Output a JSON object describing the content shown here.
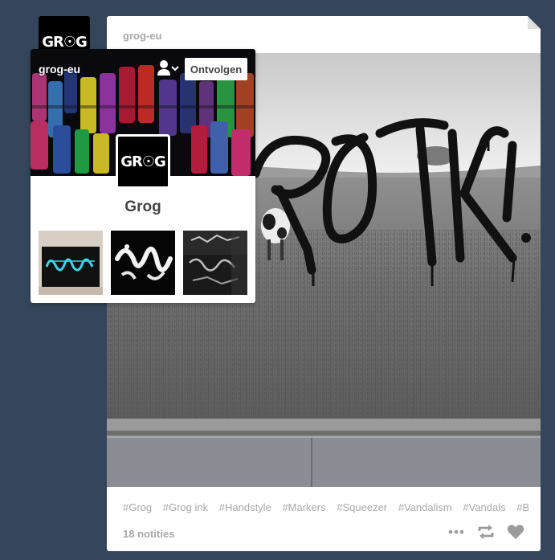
{
  "post": {
    "avatar_logo": "GR☉G",
    "blog_name": "grog-eu",
    "tags": [
      "#Grog",
      "#Grog ink",
      "#Handstyle",
      "#Markers",
      "#Squeezer",
      "#Vandalism",
      "#Vandals",
      "#Bom"
    ],
    "notes": "18 notities",
    "photo_text": "ROTK"
  },
  "popover": {
    "blog_name": "grog-eu",
    "follow_button": "Ontvolgen",
    "title": "Grog",
    "avatar_logo": "GR☉G"
  },
  "colors": {
    "dashboard_bg": "#35465c",
    "muted_text": "#a8a8a8",
    "title_text": "#444444"
  },
  "icons": {
    "more": "more-dots-icon",
    "reblog": "reblog-icon",
    "like": "heart-icon",
    "follow_menu": "user-chevron-icon"
  }
}
